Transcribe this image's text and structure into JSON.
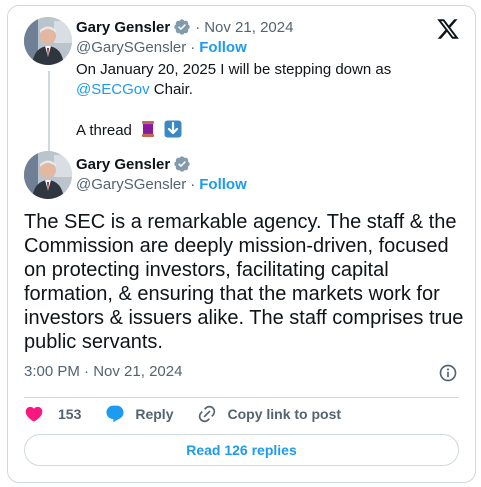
{
  "quoted_tweet": {
    "author_name": "Gary Gensler",
    "date": "Nov 21, 2024",
    "handle": "@GarySGensler",
    "follow_label": "Follow",
    "text_line1": "On January 20, 2025 I will be stepping down as",
    "mention": "@SECGov",
    "text_line2_rest": "Chair.",
    "thread_label": "A thread"
  },
  "main_tweet": {
    "author_name": "Gary Gensler",
    "handle": "@GarySGensler",
    "follow_label": "Follow",
    "text": "The SEC is a remarkable agency. The staff & the Commission are deeply mission-driven, focused on protecting investors, facilitating capital formation, & ensuring that the markets work for investors & issuers alike. The staff comprises true public servants.",
    "time": "3:00 PM",
    "date": "Nov 21, 2024"
  },
  "actions": {
    "like_count": "153",
    "reply_label": "Reply",
    "copy_link_label": "Copy link to post"
  },
  "read_replies_label": "Read 126 replies",
  "colors": {
    "accent": "#1d9bf0",
    "like": "#f91880",
    "muted": "#536471",
    "border": "#cfd9de"
  },
  "icons": [
    "verified-badge-icon",
    "x-logo-icon",
    "spool-emoji-icon",
    "down-arrow-emoji-icon",
    "info-icon",
    "heart-icon",
    "reply-bubble-icon",
    "link-icon"
  ]
}
